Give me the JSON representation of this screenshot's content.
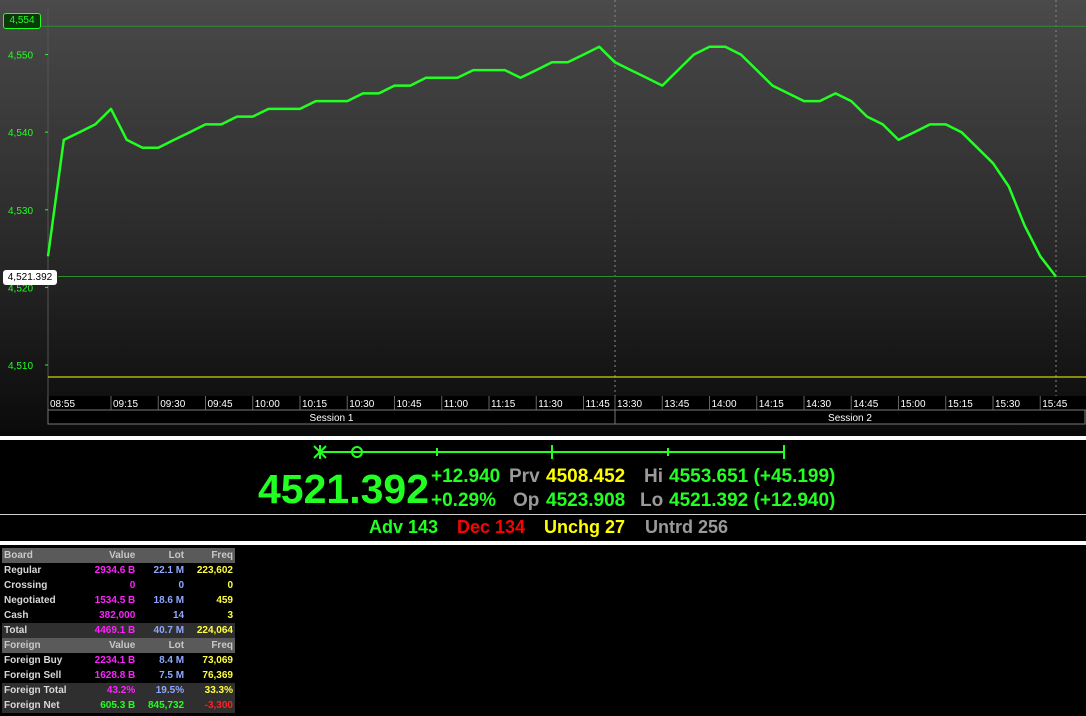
{
  "chart": {
    "y_ticks": [
      "4,550",
      "4,540",
      "4,530",
      "4,520",
      "4,510"
    ],
    "x_ticks": [
      "08:55",
      "09:15",
      "09:30",
      "09:45",
      "10:00",
      "10:15",
      "10:30",
      "10:45",
      "11:00",
      "11:15",
      "11:30",
      "11:45",
      "13:30",
      "13:45",
      "14:00",
      "14:15",
      "14:30",
      "14:45",
      "15:00",
      "15:15",
      "15:30",
      "15:45"
    ],
    "sessions": [
      "Session 1",
      "Session 2"
    ],
    "high_tag": "4,554",
    "last_tag": "4,521.392",
    "colors": {
      "line": "#22ff22",
      "grid": "#2e8b2e",
      "prev_close": "#ffff00"
    }
  },
  "chart_data": {
    "type": "line",
    "ylim": [
      4506,
      4556
    ],
    "prev_close": 4508.452,
    "x": [
      "08:55",
      "09:00",
      "09:05",
      "09:10",
      "09:15",
      "09:20",
      "09:25",
      "09:30",
      "09:35",
      "09:40",
      "09:45",
      "09:50",
      "09:55",
      "10:00",
      "10:05",
      "10:10",
      "10:15",
      "10:20",
      "10:25",
      "10:30",
      "10:35",
      "10:40",
      "10:45",
      "10:50",
      "10:55",
      "11:00",
      "11:05",
      "11:10",
      "11:15",
      "11:20",
      "11:25",
      "11:30",
      "11:35",
      "11:40",
      "11:45",
      "11:50",
      "13:30",
      "13:35",
      "13:40",
      "13:45",
      "13:50",
      "13:55",
      "14:00",
      "14:05",
      "14:10",
      "14:15",
      "14:20",
      "14:25",
      "14:30",
      "14:35",
      "14:40",
      "14:45",
      "14:50",
      "14:55",
      "15:00",
      "15:05",
      "15:10",
      "15:15",
      "15:20",
      "15:25",
      "15:30",
      "15:35",
      "15:40",
      "15:45",
      "15:49"
    ],
    "series": [
      {
        "values": [
          4524,
          4539,
          4540,
          4541,
          4543,
          4539,
          4538,
          4538,
          4539,
          4540,
          4541,
          4541,
          4542,
          4542,
          4543,
          4543,
          4543,
          4544,
          4544,
          4544,
          4545,
          4545,
          4546,
          4546,
          4547,
          4547,
          4547,
          4548,
          4548,
          4548,
          4547,
          4548,
          4549,
          4549,
          4550,
          4551,
          4549,
          4548,
          4547,
          4546,
          4548,
          4550,
          4551,
          4551,
          4550,
          4548,
          4546,
          4545,
          4544,
          4544,
          4545,
          4544,
          4542,
          4541,
          4539,
          4540,
          4541,
          4541,
          4540,
          4538,
          4536,
          4533,
          4528,
          4524,
          4521.392
        ]
      }
    ]
  },
  "ticker": {
    "last": "4521.392",
    "change": "+12.940",
    "pct": "+0.29%",
    "prv_label": "Prv",
    "prv_value": "4508.452",
    "op_label": "Op",
    "op_value": "4523.908",
    "hi_label": "Hi",
    "hi_value": "4553.651 (+45.199)",
    "lo_label": "Lo",
    "lo_value": "4521.392 (+12.940)"
  },
  "breadth": {
    "adv": "Adv 143",
    "dec": "Dec 134",
    "unchg": "Unchg 27",
    "untrd": "Untrd 256"
  },
  "board": {
    "header": [
      "Board",
      "Value",
      "Lot",
      "Freq"
    ],
    "rows": [
      {
        "label": "Regular",
        "value": "2934.6 B",
        "lot": "22.1 M",
        "freq": "223,602"
      },
      {
        "label": "Crossing",
        "value": "0",
        "lot": "0",
        "freq": "0"
      },
      {
        "label": "Negotiated",
        "value": "1534.5 B",
        "lot": "18.6 M",
        "freq": "459"
      },
      {
        "label": "Cash",
        "value": "382,000",
        "lot": "14",
        "freq": "3"
      }
    ],
    "total": {
      "label": "Total",
      "value": "4469.1 B",
      "lot": "40.7 M",
      "freq": "224,064"
    }
  },
  "foreign": {
    "header": [
      "Foreign",
      "Value",
      "Lot",
      "Freq"
    ],
    "rows": [
      {
        "label": "Foreign Buy",
        "value": "2234.1 B",
        "lot": "8.4 M",
        "freq": "73,069"
      },
      {
        "label": "Foreign Sell",
        "value": "1628.8 B",
        "lot": "7.5 M",
        "freq": "76,369"
      }
    ],
    "total": {
      "label": "Foreign Total",
      "value": "43.2%",
      "lot": "19.5%",
      "freq": "33.3%"
    },
    "net": {
      "label": "Foreign Net",
      "value": "605.3 B",
      "lot": "845,732",
      "freq": "-3,300"
    }
  }
}
